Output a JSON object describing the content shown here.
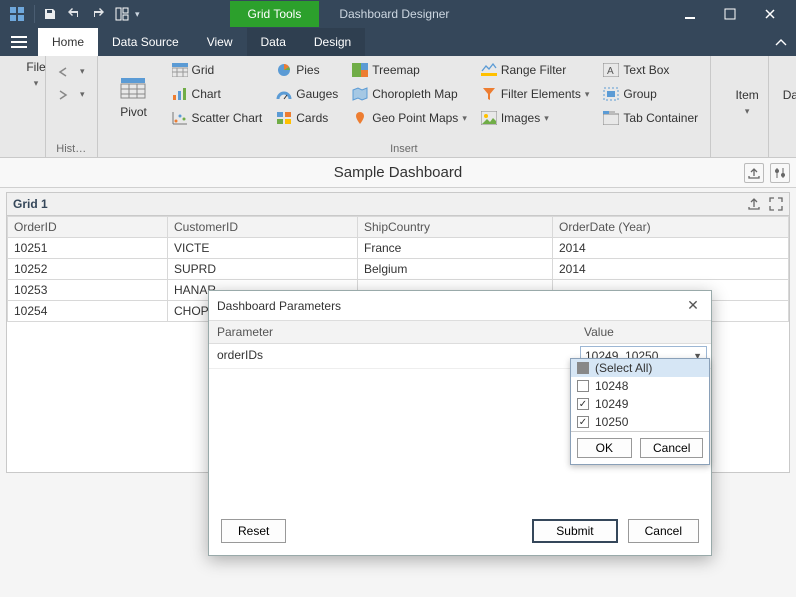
{
  "titlebar": {
    "tool_tab": "Grid Tools",
    "app_title": "Dashboard Designer"
  },
  "tabs": {
    "home": "Home",
    "data_source": "Data Source",
    "view": "View",
    "data": "Data",
    "design": "Design"
  },
  "ribbon": {
    "file": "File",
    "history": "Hist…",
    "pivot": "Pivot",
    "grid": "Grid",
    "chart": "Chart",
    "scatter": "Scatter Chart",
    "pies": "Pies",
    "gauges": "Gauges",
    "cards": "Cards",
    "treemap": "Treemap",
    "choropleth": "Choropleth Map",
    "geopoint": "Geo Point Maps",
    "range": "Range Filter",
    "filter_elements": "Filter Elements",
    "images": "Images",
    "textbox": "Text Box",
    "group": "Group",
    "tabcontainer": "Tab Container",
    "insert": "Insert",
    "item": "Item",
    "dashboard": "Dashboard"
  },
  "dashboard_title": "Sample Dashboard",
  "grid": {
    "title": "Grid 1",
    "columns": {
      "c0": "OrderID",
      "c1": "CustomerID",
      "c2": "ShipCountry",
      "c3": "OrderDate (Year)"
    },
    "rows": [
      {
        "c0": "10251",
        "c1": "VICTE",
        "c2": "France",
        "c3": "2014"
      },
      {
        "c0": "10252",
        "c1": "SUPRD",
        "c2": "Belgium",
        "c3": "2014"
      },
      {
        "c0": "10253",
        "c1": "HANAR",
        "c2": "",
        "c3": ""
      },
      {
        "c0": "10254",
        "c1": "CHOPS",
        "c2": "",
        "c3": ""
      }
    ]
  },
  "dialog": {
    "title": "Dashboard Parameters",
    "col_param": "Parameter",
    "col_value": "Value",
    "param_name": "orderIDs",
    "value": "10249, 10250",
    "reset": "Reset",
    "submit": "Submit",
    "cancel": "Cancel"
  },
  "dropdown": {
    "select_all": "(Select All)",
    "o1": "10248",
    "o2": "10249",
    "o3": "10250",
    "ok": "OK",
    "cancel": "Cancel"
  }
}
